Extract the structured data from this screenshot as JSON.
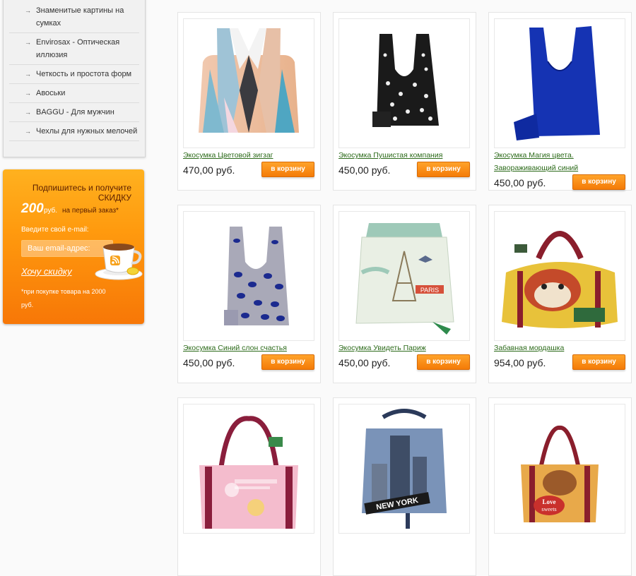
{
  "sidebar": {
    "categories": [
      {
        "label": "Знаменитые картины на сумках"
      },
      {
        "label": "Envirosax - Оптическая иллюзия"
      },
      {
        "label": "Четкость и простота форм"
      },
      {
        "label": "Авоськи"
      },
      {
        "label": "BAGGU - Для мужчин"
      },
      {
        "label": "Чехлы для нужных мелочей"
      }
    ],
    "arrow_glyph": "→"
  },
  "promo": {
    "line1": "Подпишитесь и получите",
    "line2": "СКИДКУ",
    "amount": "200",
    "currency": "руб.",
    "first_order": "на первый заказ*",
    "email_label": "Введите свой e-mail:",
    "email_placeholder": "Ваш email-адрес:",
    "email_value": "",
    "cta": "Хочу скидку",
    "footnote_line1": "*при покупке товара на 2000",
    "footnote_line2": "руб."
  },
  "buy_label": "в корзину",
  "products": [
    {
      "title": "Экосумка Цветовой зигзаг",
      "price": "470,00 руб."
    },
    {
      "title": "Экосумка Пушистая компания",
      "price": "450,00 руб."
    },
    {
      "title": "Экосумка Магия цвета. Завораживающий синий",
      "price": "450,00 руб."
    },
    {
      "title": "Экосумка Синий слон счастья",
      "price": "450,00 руб."
    },
    {
      "title": "Экосумка Увидеть Париж",
      "price": "450,00 руб."
    },
    {
      "title": "Забавная мордашка",
      "price": "954,00 руб."
    },
    {
      "title": "",
      "price": ""
    },
    {
      "title": "",
      "price": ""
    },
    {
      "title": "",
      "price": ""
    }
  ],
  "image_text": {
    "paris": "PARIS",
    "new_york": "NEW YORK",
    "love": "Love",
    "sweets": "sweets"
  },
  "colors": {
    "accent_orange": "#f47b07",
    "link_green": "#2d6b1b"
  }
}
